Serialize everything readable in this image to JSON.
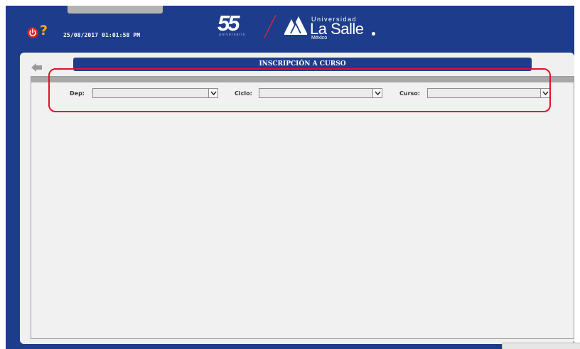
{
  "header": {
    "datetime": "25/08/2017 01:01:58 PM",
    "help_symbol": "?",
    "logo55": {
      "number": "55",
      "tagline": "aniversario"
    },
    "brand": {
      "top": "Universidad",
      "main": "La Salle",
      "sub": "México"
    }
  },
  "main": {
    "title": "INSCRIPCIÓN A CURSO",
    "filters": [
      {
        "label": "Dep:",
        "value": ""
      },
      {
        "label": "Ciclo:",
        "value": ""
      },
      {
        "label": "Curso:",
        "value": ""
      }
    ],
    "footer_button_label": ""
  },
  "colors": {
    "frame_blue": "#1d3d8c",
    "accent_orange": "#f7a51c",
    "power_red": "#e2231a",
    "highlight_red": "#e2102a",
    "panel_gray": "#f1f1f1"
  },
  "icons": [
    "power-icon",
    "help-icon",
    "back-arrow-icon",
    "chevron-down-icon"
  ]
}
